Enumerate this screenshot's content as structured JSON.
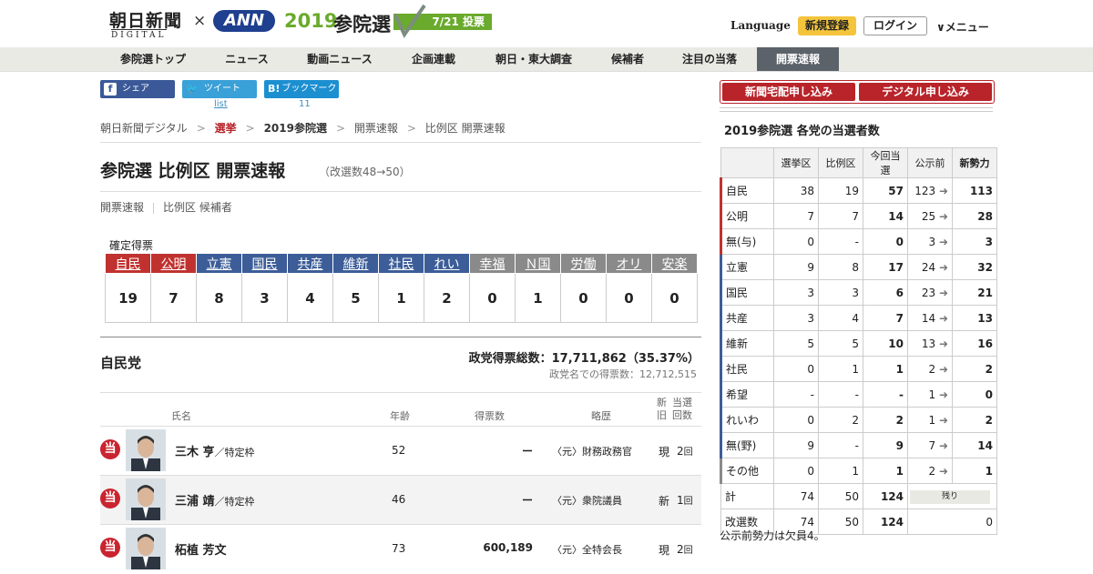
{
  "header": {
    "logo_main": "朝日新聞",
    "logo_sub": "DIGITAL",
    "times": "×",
    "ann": "ANN",
    "year": "2019",
    "election": "参院選",
    "vote_date": "7/21 投票",
    "language": "Language",
    "register": "新規登録",
    "login": "ログイン",
    "menu": "∨メニュー"
  },
  "nav": {
    "items": [
      "参院選トップ",
      "ニュース",
      "動画ニュース",
      "企画連載",
      "朝日・東大調査",
      "候補者",
      "注目の当落",
      "開票速報"
    ]
  },
  "share": {
    "facebook": "シェア",
    "twitter": "ツイート",
    "hatena": "ブックマーク",
    "twitter_count": "list",
    "hatena_count": "11"
  },
  "breadcrumb": [
    "朝日新聞デジタル",
    "選挙",
    "2019参院選",
    "開票速報",
    "比例区 開票速報"
  ],
  "page": {
    "title": "参院選 比例区 開票速報",
    "subtitle": "（改選数48→50）",
    "subnav": [
      "開票速報",
      "比例区 候補者"
    ]
  },
  "confirmed": {
    "label": "確定得票",
    "parties": [
      {
        "name": "自民",
        "value": "19",
        "color": "#c0322f"
      },
      {
        "name": "公明",
        "value": "7",
        "color": "#c0322f"
      },
      {
        "name": "立憲",
        "value": "8",
        "color": "#3c5d98"
      },
      {
        "name": "国民",
        "value": "3",
        "color": "#3c5d98"
      },
      {
        "name": "共産",
        "value": "4",
        "color": "#3c5d98"
      },
      {
        "name": "維新",
        "value": "5",
        "color": "#3c5d98"
      },
      {
        "name": "社民",
        "value": "1",
        "color": "#3c5d98"
      },
      {
        "name": "れい",
        "value": "2",
        "color": "#3c5d98"
      },
      {
        "name": "幸福",
        "value": "0",
        "color": "#8a8a8a"
      },
      {
        "name": "Ｎ国",
        "value": "1",
        "color": "#8a8a8a"
      },
      {
        "name": "労働",
        "value": "0",
        "color": "#8a8a8a"
      },
      {
        "name": "オリ",
        "value": "0",
        "color": "#8a8a8a"
      },
      {
        "name": "安楽",
        "value": "0",
        "color": "#8a8a8a"
      }
    ]
  },
  "party_section": {
    "name": "自民党",
    "total": "政党得票総数：17,711,862（35.37%）",
    "sub": "政党名での得票数：12,712,515",
    "columns": {
      "name": "氏名",
      "age": "年齢",
      "votes": "得票数",
      "career": "略歴",
      "status": "新旧",
      "count": "当選回数"
    },
    "candidates": [
      {
        "win": "当",
        "name": "三木 亨",
        "tag": "／特定枠",
        "age": "52",
        "votes": "ー",
        "career": "〈元〉財務政務官",
        "status": "現",
        "count": "2",
        "count_unit": "回"
      },
      {
        "win": "当",
        "name": "三浦 靖",
        "tag": "／特定枠",
        "age": "46",
        "votes": "ー",
        "career": "〈元〉衆院議員",
        "status": "新",
        "count": "1",
        "count_unit": "回"
      },
      {
        "win": "当",
        "name": "柘植 芳文",
        "tag": "",
        "age": "73",
        "votes": "600,189",
        "career": "〈元〉全特会長",
        "status": "現",
        "count": "2",
        "count_unit": "回"
      }
    ]
  },
  "sidebar": {
    "buttons": [
      "新聞宅配申し込み",
      "デジタル申し込み"
    ],
    "title": "2019参院選 各党の当選者数",
    "headers": [
      "",
      "選挙区",
      "比例区",
      "今回当選",
      "公示前",
      "新勢力"
    ],
    "arrow": "➜",
    "rows": [
      {
        "party": "自民",
        "district": "38",
        "pr": "19",
        "won": "57",
        "before": "123",
        "new": "113",
        "color": "#c0322f"
      },
      {
        "party": "公明",
        "district": "7",
        "pr": "7",
        "won": "14",
        "before": "25",
        "new": "28",
        "color": "#c0322f"
      },
      {
        "party": "無(与)",
        "district": "0",
        "pr": "-",
        "won": "0",
        "before": "3",
        "new": "3",
        "color": "#c0322f"
      },
      {
        "party": "立憲",
        "district": "9",
        "pr": "8",
        "won": "17",
        "before": "24",
        "new": "32",
        "color": "#3c5d98"
      },
      {
        "party": "国民",
        "district": "3",
        "pr": "3",
        "won": "6",
        "before": "23",
        "new": "21",
        "color": "#3c5d98"
      },
      {
        "party": "共産",
        "district": "3",
        "pr": "4",
        "won": "7",
        "before": "14",
        "new": "13",
        "color": "#3c5d98"
      },
      {
        "party": "維新",
        "district": "5",
        "pr": "5",
        "won": "10",
        "before": "13",
        "new": "16",
        "color": "#3c5d98"
      },
      {
        "party": "社民",
        "district": "0",
        "pr": "1",
        "won": "1",
        "before": "2",
        "new": "2",
        "color": "#3c5d98"
      },
      {
        "party": "希望",
        "district": "-",
        "pr": "-",
        "won": "-",
        "before": "1",
        "new": "0",
        "color": "#3c5d98"
      },
      {
        "party": "れいわ",
        "district": "0",
        "pr": "2",
        "won": "2",
        "before": "1",
        "new": "2",
        "color": "#3c5d98"
      },
      {
        "party": "無(野)",
        "district": "9",
        "pr": "-",
        "won": "9",
        "before": "7",
        "new": "14",
        "color": "#3c5d98"
      },
      {
        "party": "その他",
        "district": "0",
        "pr": "1",
        "won": "1",
        "before": "2",
        "new": "1",
        "color": "#8a8a8a"
      }
    ],
    "total_label": "計",
    "total": {
      "district": "74",
      "pr": "50",
      "won": "124",
      "remain": "残り"
    },
    "seats_label": "改選数",
    "seats": {
      "district": "74",
      "pr": "50",
      "won": "124",
      "remain_value": "0"
    },
    "note": "公示前勢力は欠員4。"
  }
}
